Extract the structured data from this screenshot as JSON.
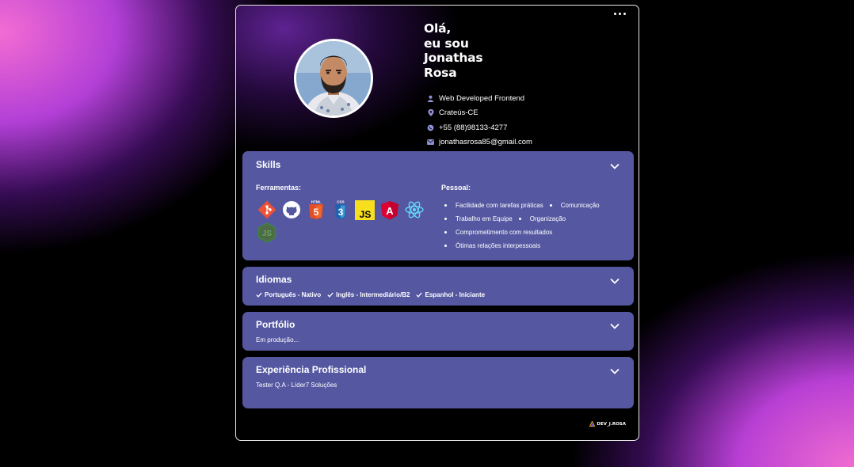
{
  "header": {
    "greeting": "Olá,\neu sou\nJonathas\nRosa"
  },
  "contacts": [
    {
      "icon": "person-icon",
      "text": "Web Developed Frontend"
    },
    {
      "icon": "location-pin-icon",
      "text": "Crateús-CE"
    },
    {
      "icon": "whatsapp-icon",
      "text": "+55 (88)98133-4277"
    },
    {
      "icon": "envelope-icon",
      "text": "jonathasrosa85@gmail.com"
    }
  ],
  "skills": {
    "title": "Skills",
    "tools_label": "Ferramentas:",
    "tools": [
      {
        "icon": "git-icon",
        "color": "#f05033"
      },
      {
        "icon": "github-icon",
        "color": "#ffffff"
      },
      {
        "icon": "html5-icon",
        "color": "#e44d26",
        "label": "HTML",
        "number": "5"
      },
      {
        "icon": "css3-icon",
        "color": "#2062af",
        "label": "CSS",
        "number": "3"
      },
      {
        "icon": "javascript-icon",
        "color": "#f7df1e",
        "label": "JS"
      },
      {
        "icon": "angular-icon",
        "color": "#dd0031",
        "label": "A"
      },
      {
        "icon": "react-icon",
        "color": "#61dafb"
      },
      {
        "icon": "nodejs-icon",
        "color": "#3c873a",
        "label": "JS"
      }
    ],
    "soft_label": "Pessoal:",
    "soft_rows": [
      [
        "Facilidade com tarefas práticas",
        "Comunicação"
      ],
      [
        "Trabalho em Equipe",
        "Organização"
      ],
      [
        "Comprometimento com resultados"
      ],
      [
        "Ótimas relações interpessoais"
      ]
    ]
  },
  "languages": {
    "title": "Idiomas",
    "items": [
      "Português - Nativo",
      "Inglês - Intermediário/B2",
      "Espanhol - Iniciante"
    ]
  },
  "portfolio": {
    "title": "Portfólio",
    "text": "Em produção..."
  },
  "experience": {
    "title": "Experiência Profissional",
    "text": "Tester Q.A - Líder7 Soluções"
  },
  "footer": {
    "logo_text": "DEV_J.ROSA"
  },
  "colors": {
    "panel": "#5558a1",
    "icon_accent": "#8f92d8"
  }
}
